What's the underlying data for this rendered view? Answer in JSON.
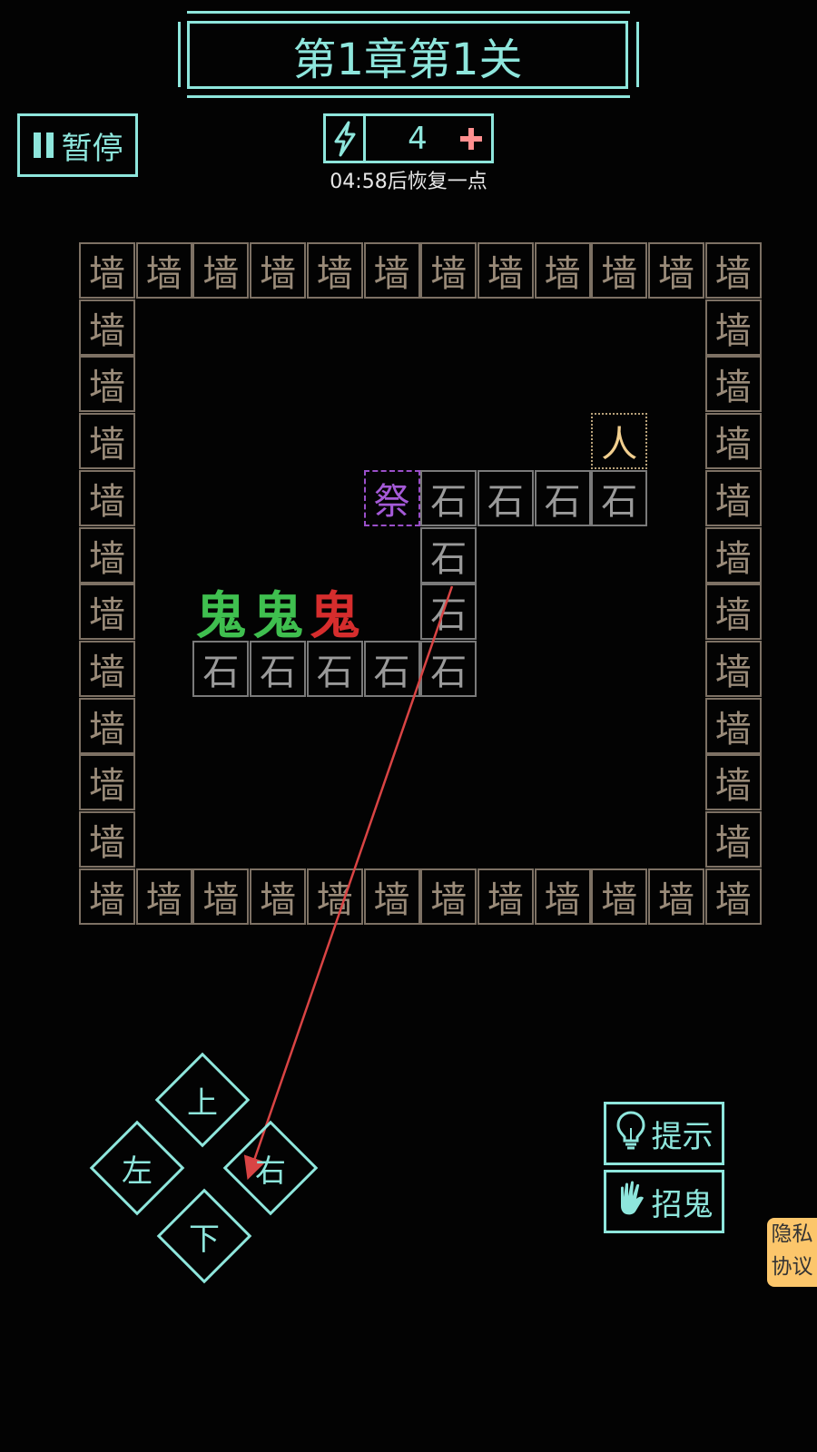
{
  "header": {
    "title": "第1章第1关"
  },
  "pause": {
    "label": "暂停"
  },
  "energy": {
    "count": "4",
    "recover_text": "04:58后恢复一点",
    "bolt_icon": "lightning-bolt-icon",
    "plus_icon": "plus-icon",
    "plus_color": "#ff8f8f"
  },
  "board": {
    "wall_label": "墙",
    "stone_label": "石",
    "altar_label": "祭",
    "person_label": "人",
    "ghost_label": "鬼",
    "ghost_colors": [
      "#3fbf4f",
      "#3fbf4f",
      "#d62d2d"
    ]
  },
  "controls": {
    "up": "上",
    "left": "左",
    "right": "右",
    "down": "下"
  },
  "actions": {
    "hint": "提示",
    "summon": "招鬼"
  },
  "privacy": {
    "line1": "隐私",
    "line2": "协议"
  },
  "colors": {
    "accent": "#8ee6dc",
    "arrow": "#d94444"
  }
}
